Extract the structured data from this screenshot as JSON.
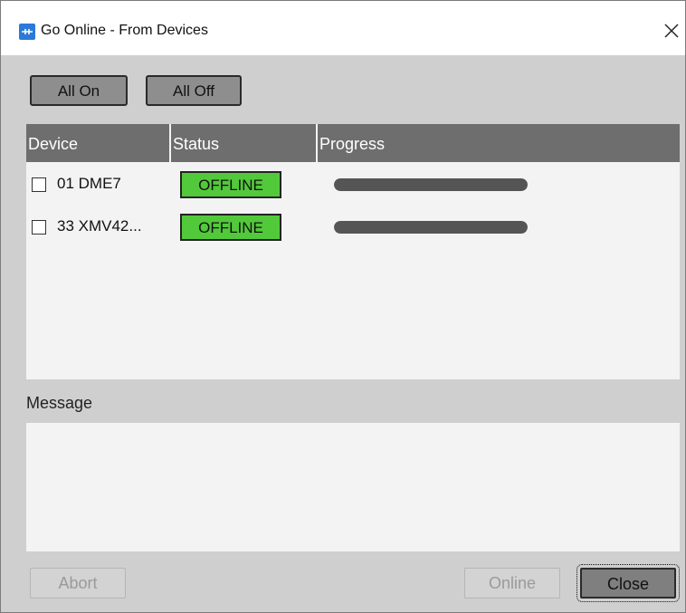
{
  "window": {
    "title": "Go Online - From Devices",
    "icon": "app-icon",
    "close_icon": "close-icon"
  },
  "toolbar": {
    "all_on_label": "All On",
    "all_off_label": "All Off"
  },
  "device_list": {
    "columns": [
      "Device",
      "Status",
      "Progress"
    ],
    "rows": [
      {
        "checked": false,
        "device": "01 DME7",
        "status": "OFFLINE",
        "progress": 1.0
      },
      {
        "checked": false,
        "device": "33 XMV42...",
        "status": "OFFLINE",
        "progress": 1.0
      }
    ]
  },
  "message": {
    "label": "Message",
    "text": ""
  },
  "footer": {
    "abort_label": "Abort",
    "online_label": "Online",
    "close_label": "Close"
  },
  "colors": {
    "status_offline": "#52c93a",
    "header_bg": "#6e6e6e",
    "progress_fill": "#555555",
    "app_icon": "#2b79d8"
  }
}
